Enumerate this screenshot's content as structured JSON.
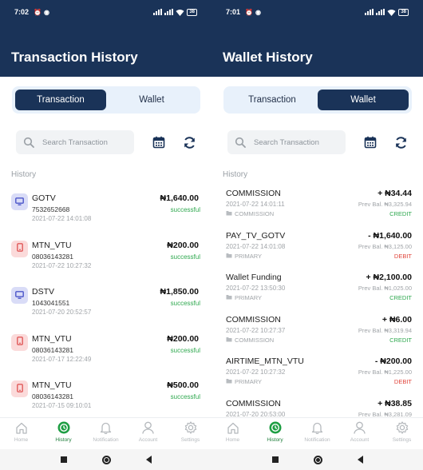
{
  "left": {
    "time": "7:02",
    "battery": "38",
    "title": "Transaction History",
    "tabs": [
      {
        "label": "Transaction",
        "active": true
      },
      {
        "label": "Wallet",
        "active": false
      }
    ],
    "search_placeholder": "Search Transaction",
    "section": "History",
    "transactions": [
      {
        "name": "GOTV",
        "phone": "7532652668",
        "date": "2021-07-22 14:01:08",
        "amount": "₦1,640.00",
        "status": "successful",
        "icon": "tv-icon"
      },
      {
        "name": "MTN_VTU",
        "phone": "08036143281",
        "date": "2021-07-22 10:27:32",
        "amount": "₦200.00",
        "status": "successful",
        "icon": "phone-icon"
      },
      {
        "name": "DSTV",
        "phone": "1043041551",
        "date": "2021-07-20 20:52:57",
        "amount": "₦1,850.00",
        "status": "successful",
        "icon": "tv-icon"
      },
      {
        "name": "MTN_VTU",
        "phone": "08036143281",
        "date": "2021-07-17 12:22:49",
        "amount": "₦200.00",
        "status": "successful",
        "icon": "phone-icon"
      },
      {
        "name": "MTN_VTU",
        "phone": "08036143281",
        "date": "2021-07-15 09:10:01",
        "amount": "₦500.00",
        "status": "successful",
        "icon": "phone-icon"
      }
    ]
  },
  "right": {
    "time": "7:01",
    "battery": "38",
    "title": "Wallet History",
    "tabs": [
      {
        "label": "Transaction",
        "active": false
      },
      {
        "label": "Wallet",
        "active": true
      }
    ],
    "search_placeholder": "Search Transaction",
    "section": "History",
    "wallet": [
      {
        "name": "COMMISSION",
        "date": "2021-07-22 14:01:11",
        "tag": "COMMISSION",
        "amount": "+ ₦34.44",
        "prev": "Prev Bal. ₦3,325.94",
        "type": "CREDIT"
      },
      {
        "name": "PAY_TV_GOTV",
        "date": "2021-07-22 14:01:08",
        "tag": "PRIMARY",
        "amount": "- ₦1,640.00",
        "prev": "Prev Bal. ₦3,125.00",
        "type": "DEBIT"
      },
      {
        "name": "Wallet Funding",
        "date": "2021-07-22 13:50:30",
        "tag": "PRIMARY",
        "amount": "+ ₦2,100.00",
        "prev": "Prev Bal. ₦1,025.00",
        "type": "CREDIT"
      },
      {
        "name": "COMMISSION",
        "date": "2021-07-22 10:27:37",
        "tag": "COMMISSION",
        "amount": "+ ₦6.00",
        "prev": "Prev Bal. ₦3,319.94",
        "type": "CREDIT"
      },
      {
        "name": "AIRTIME_MTN_VTU",
        "date": "2021-07-22 10:27:32",
        "tag": "PRIMARY",
        "amount": "- ₦200.00",
        "prev": "Prev Bal. ₦1,225.00",
        "type": "DEBIT"
      },
      {
        "name": "COMMISSION",
        "date": "2021-07-20 20:53:00",
        "tag": "",
        "amount": "+ ₦38.85",
        "prev": "Prev Bal. ₦3,281.09",
        "type": ""
      }
    ]
  },
  "nav": [
    {
      "label": "Home",
      "icon": "home-icon"
    },
    {
      "label": "History",
      "icon": "history-icon",
      "active": true
    },
    {
      "label": "Notification",
      "icon": "bell-icon"
    },
    {
      "label": "Account",
      "icon": "account-icon"
    },
    {
      "label": "Settings",
      "icon": "settings-icon"
    }
  ],
  "colors": {
    "header": "#1a3358",
    "credit": "#2fa84f",
    "debit": "#e0463c",
    "active_nav": "#1e7d3a"
  }
}
